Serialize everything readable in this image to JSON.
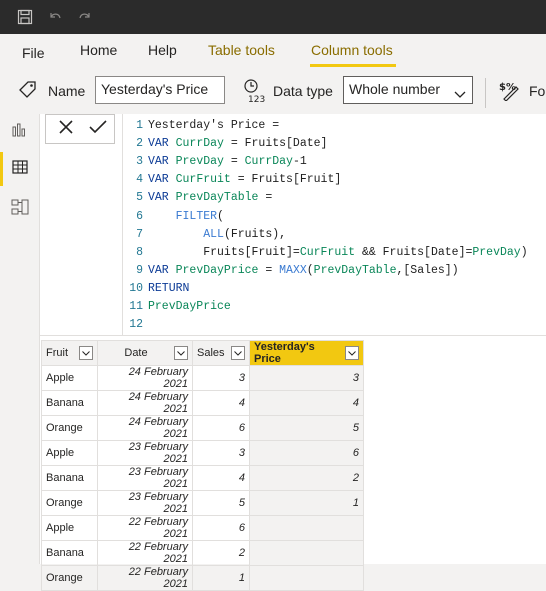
{
  "menu": {
    "file": "File",
    "home": "Home",
    "help": "Help",
    "table_tools": "Table tools",
    "column_tools": "Column tools"
  },
  "ribbon": {
    "name_label": "Name",
    "name_value": "Yesterday's Price",
    "datatype_label": "Data type",
    "datatype_value": "Whole number",
    "format_label": "Fo"
  },
  "editor": {
    "lines": [
      {
        "n": "1",
        "parts": [
          {
            "t": "txt",
            "s": "Yesterday's Price = "
          }
        ]
      },
      {
        "n": "2",
        "parts": [
          {
            "t": "kw",
            "s": "VAR "
          },
          {
            "t": "var",
            "s": "CurrDay"
          },
          {
            "t": "txt",
            "s": " = Fruits[Date]"
          }
        ]
      },
      {
        "n": "3",
        "parts": [
          {
            "t": "kw",
            "s": "VAR "
          },
          {
            "t": "var",
            "s": "PrevDay"
          },
          {
            "t": "txt",
            "s": " = "
          },
          {
            "t": "var",
            "s": "CurrDay"
          },
          {
            "t": "txt",
            "s": "-1"
          }
        ]
      },
      {
        "n": "4",
        "parts": [
          {
            "t": "kw",
            "s": "VAR "
          },
          {
            "t": "var",
            "s": "CurFruit"
          },
          {
            "t": "txt",
            "s": " = Fruits[Fruit]"
          }
        ]
      },
      {
        "n": "5",
        "parts": [
          {
            "t": "kw",
            "s": "VAR "
          },
          {
            "t": "var",
            "s": "PrevDayTable"
          },
          {
            "t": "txt",
            "s": " ="
          }
        ]
      },
      {
        "n": "6",
        "parts": [
          {
            "t": "txt",
            "s": "    "
          },
          {
            "t": "fn",
            "s": "FILTER"
          },
          {
            "t": "txt",
            "s": "("
          }
        ]
      },
      {
        "n": "7",
        "parts": [
          {
            "t": "txt",
            "s": "        "
          },
          {
            "t": "fn",
            "s": "ALL"
          },
          {
            "t": "txt",
            "s": "(Fruits),"
          }
        ]
      },
      {
        "n": "8",
        "parts": [
          {
            "t": "txt",
            "s": "        Fruits[Fruit]="
          },
          {
            "t": "var",
            "s": "CurFruit"
          },
          {
            "t": "txt",
            "s": " && Fruits[Date]="
          },
          {
            "t": "var",
            "s": "PrevDay"
          },
          {
            "t": "txt",
            "s": ")"
          }
        ]
      },
      {
        "n": "9",
        "parts": [
          {
            "t": "kw",
            "s": "VAR "
          },
          {
            "t": "var",
            "s": "PrevDayPrice"
          },
          {
            "t": "txt",
            "s": " = "
          },
          {
            "t": "fn",
            "s": "MAXX"
          },
          {
            "t": "txt",
            "s": "("
          },
          {
            "t": "var",
            "s": "PrevDayTable"
          },
          {
            "t": "txt",
            "s": ",[Sales])"
          }
        ]
      },
      {
        "n": "10",
        "parts": [
          {
            "t": "kw",
            "s": "RETURN"
          }
        ]
      },
      {
        "n": "11",
        "parts": [
          {
            "t": "var",
            "s": "PrevDayPrice"
          }
        ]
      },
      {
        "n": "12",
        "parts": []
      }
    ]
  },
  "table": {
    "columns": [
      "Fruit",
      "Date",
      "Sales",
      "Yesterday's Price"
    ],
    "rows": [
      [
        "Apple",
        "24 February 2021",
        "3",
        "3"
      ],
      [
        "Banana",
        "24 February 2021",
        "4",
        "4"
      ],
      [
        "Orange",
        "24 February 2021",
        "6",
        "5"
      ],
      [
        "Apple",
        "23 February 2021",
        "3",
        "6"
      ],
      [
        "Banana",
        "23 February 2021",
        "4",
        "2"
      ],
      [
        "Orange",
        "23 February 2021",
        "5",
        "1"
      ],
      [
        "Apple",
        "22 February 2021",
        "6",
        ""
      ],
      [
        "Banana",
        "22 February 2021",
        "2",
        ""
      ],
      [
        "Orange",
        "22 February 2021",
        "1",
        ""
      ]
    ]
  },
  "colors": {
    "accent": "#f2c811",
    "titlebar": "#2b2b2b"
  }
}
